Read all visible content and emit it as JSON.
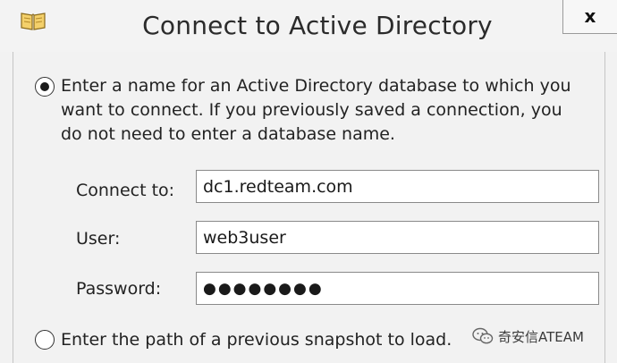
{
  "window": {
    "title": "Connect to Active Directory",
    "close_label": "x",
    "app_icon": "book-icon"
  },
  "options": {
    "database": {
      "selected": true,
      "line1": "Enter a name for an Active Directory database to which you",
      "line2": "want to connect. If you previously saved a connection, you",
      "line3": "do not need to enter a database name."
    },
    "snapshot": {
      "selected": false,
      "label": "Enter the path of a previous snapshot to load."
    }
  },
  "fields": {
    "connect_to": {
      "label": "Connect to:",
      "value": "dc1.redteam.com"
    },
    "user": {
      "label": "User:",
      "value": "web3user"
    },
    "password": {
      "label": "Password:",
      "value": "●●●●●●●●"
    }
  },
  "watermark": {
    "icon": "wechat-icon",
    "text": "奇安信ATEAM"
  }
}
